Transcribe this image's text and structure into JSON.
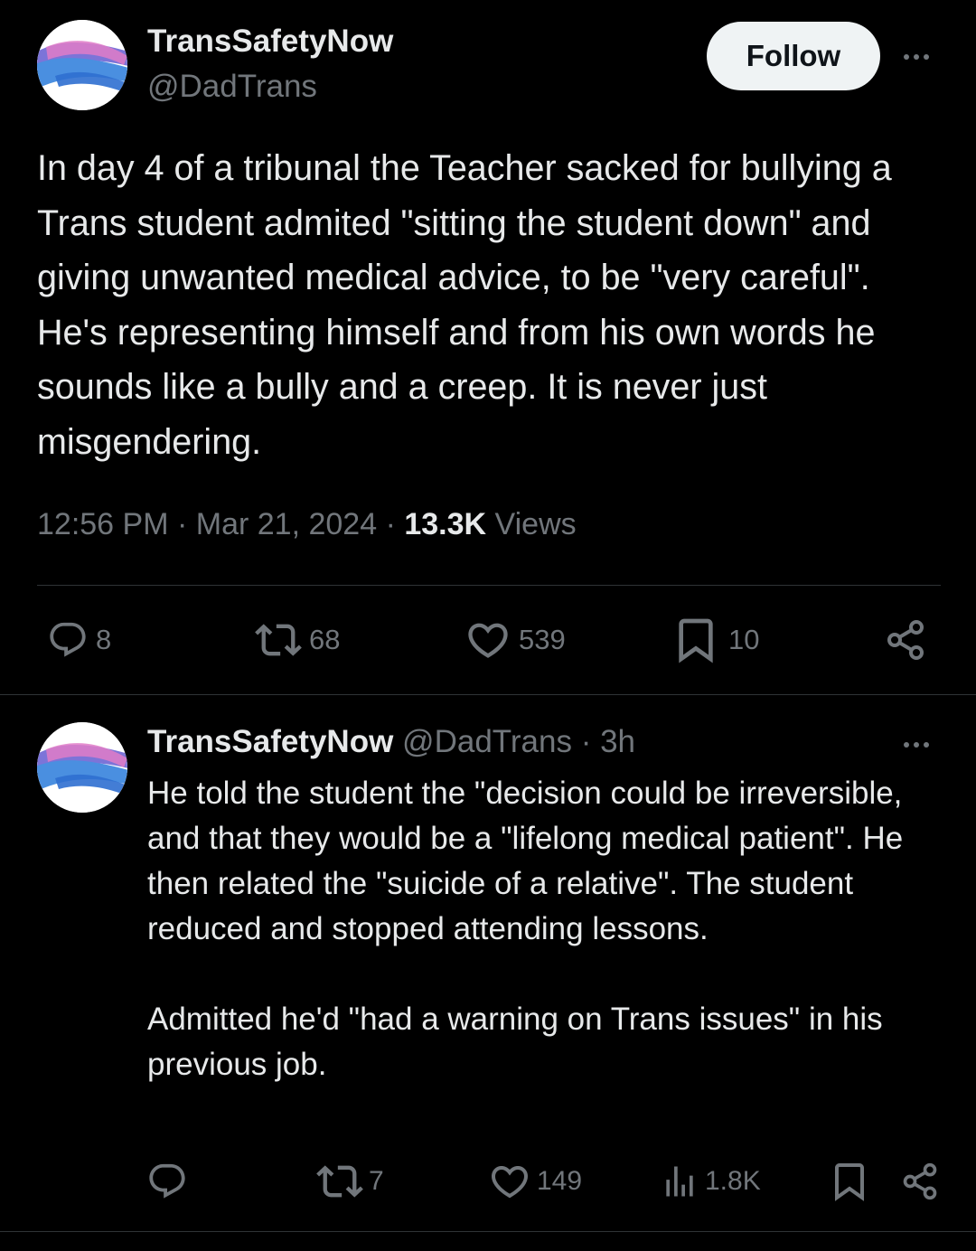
{
  "main_tweet": {
    "display_name": "TransSafetyNow",
    "handle": "@DadTrans",
    "follow_label": "Follow",
    "text": "In day 4 of a tribunal the Teacher sacked for bullying a Trans student admited \"sitting the student down\" and giving unwanted medical advice, to be \"very careful\". He's representing himself and from his own words he sounds like a bully and a creep. It is never just misgendering.",
    "time": "12:56 PM",
    "date": "Mar 21, 2024",
    "sep": "·",
    "views_count": "13.3K",
    "views_label": "Views",
    "actions": {
      "replies": "8",
      "reposts": "68",
      "likes": "539",
      "bookmarks": "10"
    }
  },
  "reply_tweet": {
    "display_name": "TransSafetyNow",
    "handle": "@DadTrans",
    "sep": "·",
    "time_ago": "3h",
    "text": "He told the student the \"decision could be irreversible, and that they would be a \"lifelong medical patient\". He then related the \"suicide of a relative\". The student reduced and stopped attending lessons.\n\nAdmitted he'd \"had a warning on Trans issues\" in his previous job.",
    "actions": {
      "reposts": "7",
      "likes": "149",
      "views": "1.8K"
    }
  },
  "colors": {
    "background": "#000000",
    "text_primary": "#e7e9ea",
    "text_secondary": "#71767b",
    "divider": "#2f3336",
    "follow_bg": "#eff3f4"
  },
  "icons": [
    "reply-icon",
    "repost-icon",
    "like-icon",
    "bookmark-icon",
    "share-icon",
    "views-icon",
    "more-icon"
  ]
}
